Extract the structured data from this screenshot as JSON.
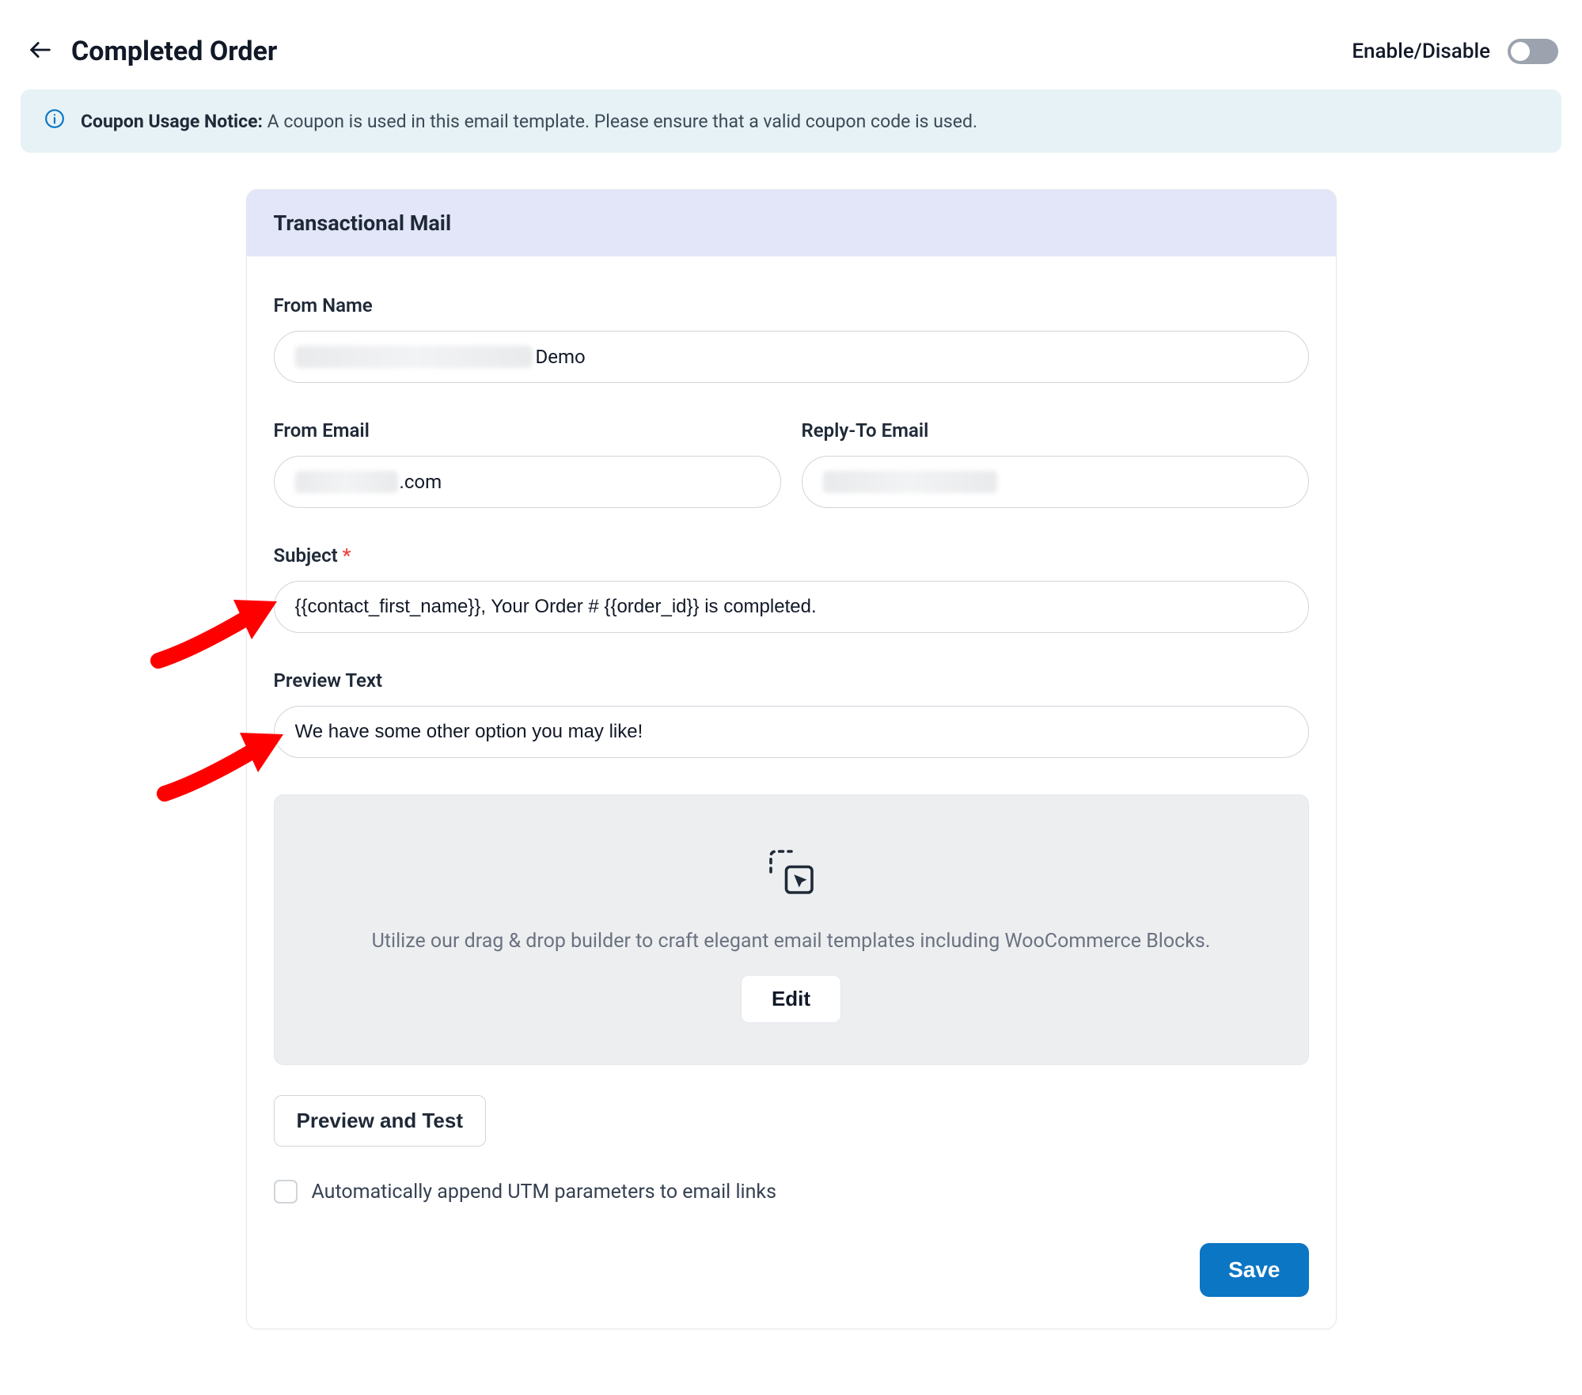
{
  "header": {
    "title": "Completed Order",
    "toggle_label": "Enable/Disable",
    "toggle_on": false
  },
  "notice": {
    "prefix": "Coupon Usage Notice:",
    "message": " A coupon is used in this email template. Please ensure that a valid coupon code is used."
  },
  "card": {
    "title": "Transactional Mail",
    "from_name_label": "From Name",
    "from_name_suffix": " Demo",
    "from_email_label": "From Email",
    "from_email_suffix": ".com",
    "reply_to_label": "Reply-To Email",
    "subject_label": "Subject",
    "subject_value": "{{contact_first_name}}, Your Order # {{order_id}} is completed.",
    "preview_text_label": "Preview Text",
    "preview_text_value": "We have some other option you may like!",
    "builder_description": "Utilize our drag & drop builder to craft elegant email templates including WooCommerce Blocks.",
    "builder_edit_label": "Edit",
    "preview_test_label": "Preview and Test",
    "utm_checkbox_label": "Automatically append UTM parameters to email links",
    "utm_checked": false,
    "save_label": "Save"
  }
}
